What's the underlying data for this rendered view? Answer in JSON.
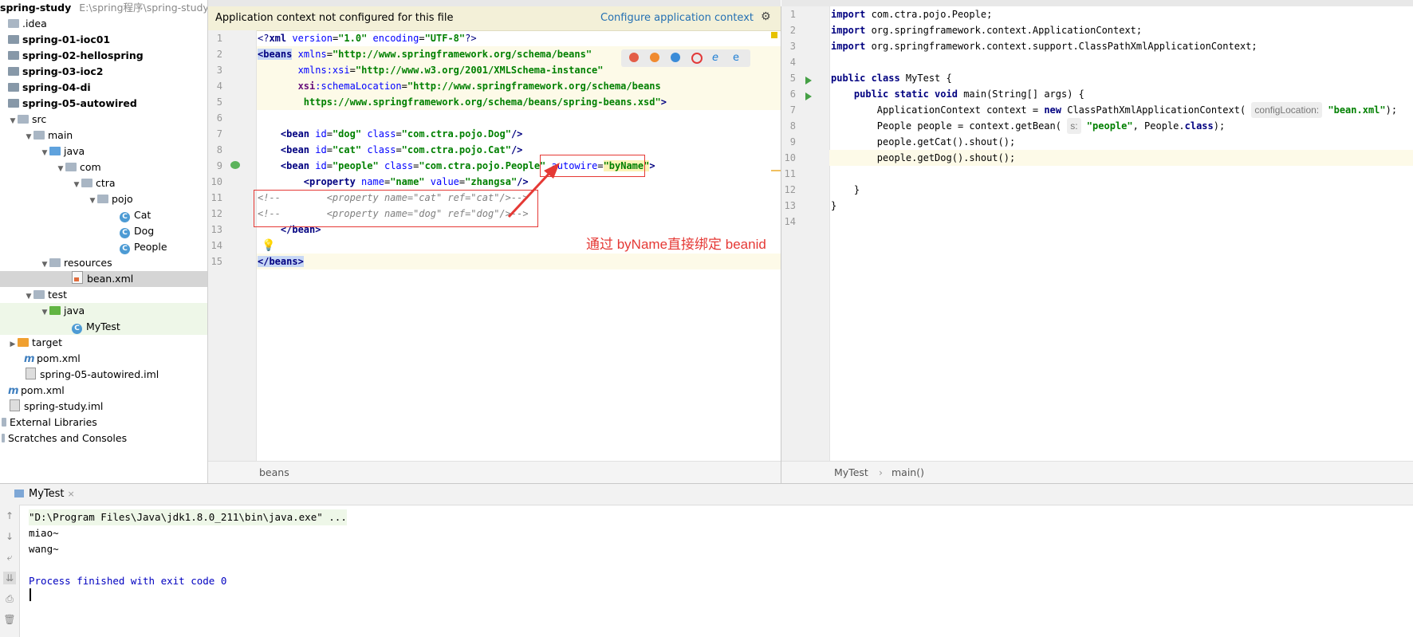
{
  "project": {
    "root_label": "spring-study",
    "root_path": "E:\\spring程序\\spring-study",
    "items": [
      {
        "label": "spring-study",
        "depth": 0
      },
      {
        "label": ".idea"
      },
      {
        "label": "spring-01-ioc01"
      },
      {
        "label": "spring-02-hellospring"
      },
      {
        "label": "spring-03-ioc2"
      },
      {
        "label": "spring-04-di"
      },
      {
        "label": "spring-05-autowired"
      },
      {
        "label": "src"
      },
      {
        "label": "main"
      },
      {
        "label": "java"
      },
      {
        "label": "com"
      },
      {
        "label": "ctra"
      },
      {
        "label": "pojo"
      },
      {
        "label": "Cat"
      },
      {
        "label": "Dog"
      },
      {
        "label": "People"
      },
      {
        "label": "resources"
      },
      {
        "label": "bean.xml"
      },
      {
        "label": "test"
      },
      {
        "label": "java"
      },
      {
        "label": "MyTest"
      },
      {
        "label": "target"
      },
      {
        "label": "pom.xml"
      },
      {
        "label": "spring-05-autowired.iml"
      },
      {
        "label": "pom.xml"
      },
      {
        "label": "spring-study.iml"
      },
      {
        "label": "External Libraries"
      },
      {
        "label": "Scratches and Consoles"
      }
    ]
  },
  "xml_editor": {
    "banner_text": "Application context not configured for this file",
    "banner_link": "Configure application context",
    "breadcrumb": "beans",
    "line_numbers": [
      "1",
      "2",
      "3",
      "4",
      "5",
      "6",
      "7",
      "8",
      "9",
      "10",
      "11",
      "12",
      "13",
      "14",
      "15"
    ]
  },
  "java_editor": {
    "breadcrumb_class": "MyTest",
    "breadcrumb_sep": "›",
    "breadcrumb_method": "main()",
    "line_numbers": [
      "1",
      "2",
      "3",
      "4",
      "5",
      "6",
      "7",
      "8",
      "9",
      "10",
      "11",
      "12",
      "13",
      "14"
    ],
    "hint_config": "configLocation:",
    "hint_s": "s:"
  },
  "annotation": {
    "text": "通过 byName直接绑定 beanid",
    "color": "#e53935"
  },
  "run": {
    "tab_label": "MyTest",
    "tab_close": "×",
    "console_lines": [
      "\"D:\\Program Files\\Java\\jdk1.8.0_211\\bin\\java.exe\" ...",
      "miao~",
      "wang~",
      "",
      "Process finished with exit code 0"
    ]
  },
  "colors": {
    "keyword": "#000080",
    "string": "#008000",
    "attribute": "#0000ff",
    "comment": "#808080",
    "link": "#2470b3",
    "banner_bg": "#f3f0d8"
  }
}
